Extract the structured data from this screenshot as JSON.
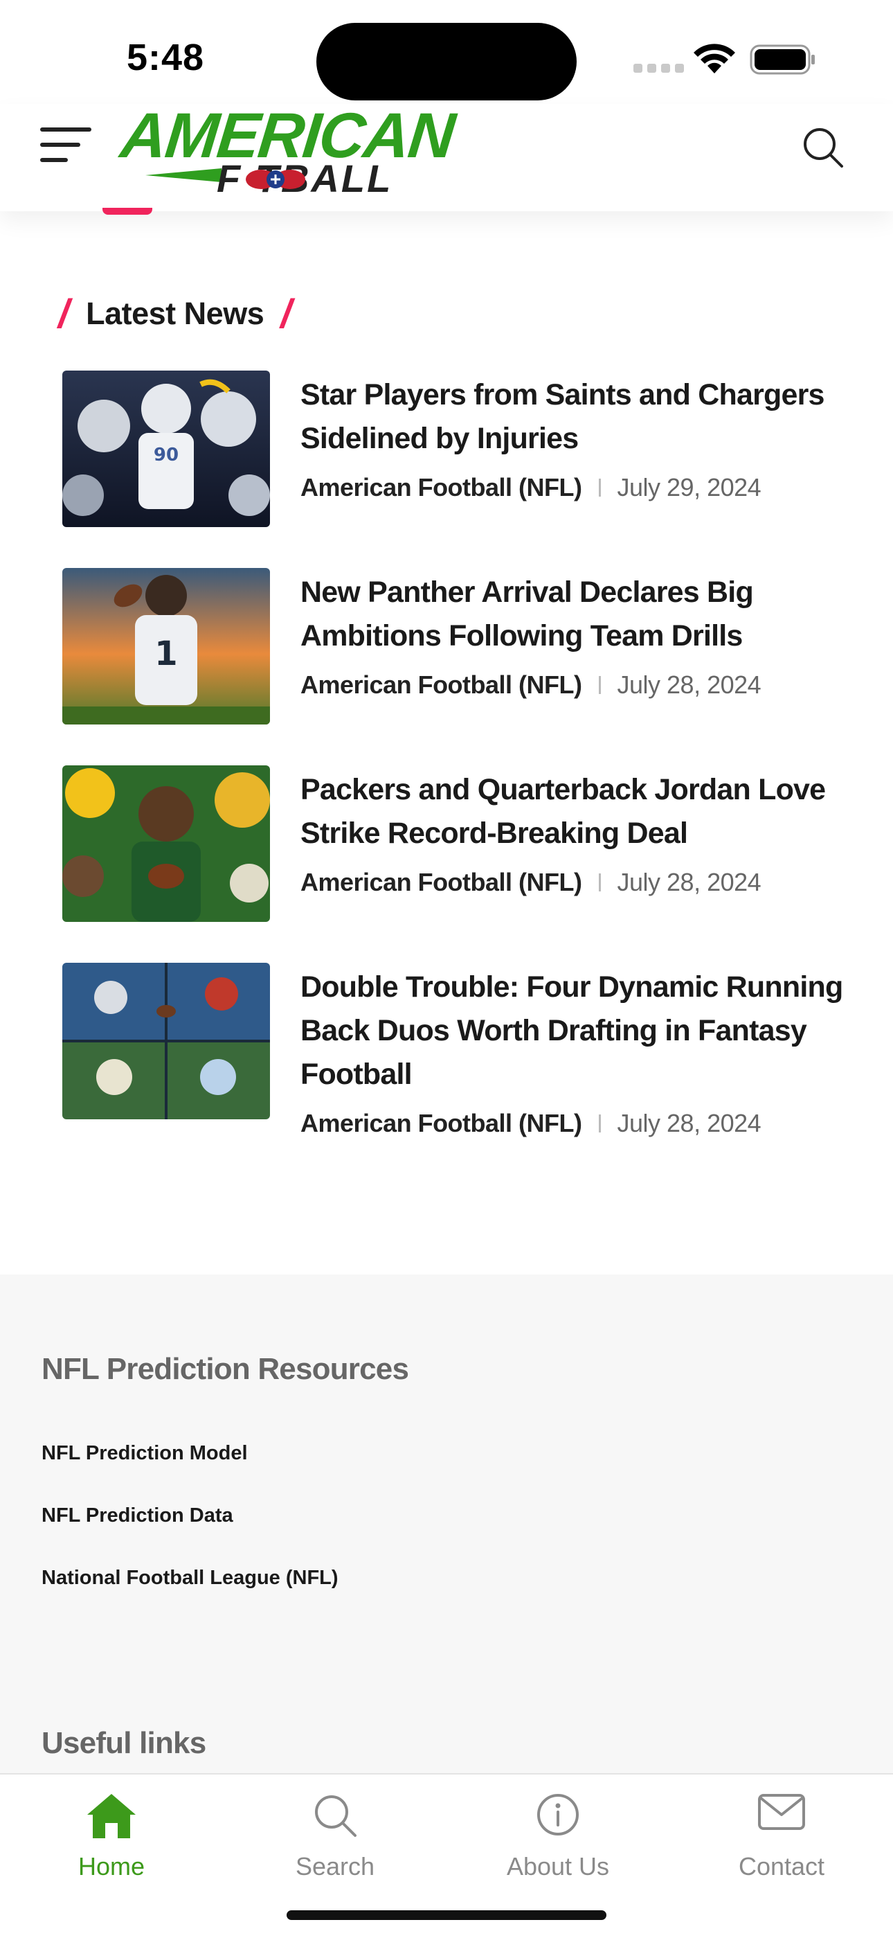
{
  "status_bar": {
    "time": "5:48"
  },
  "header": {
    "logo_line1": "AMERICAN",
    "logo_line2": "F  TBALL"
  },
  "section": {
    "title": "Latest News"
  },
  "news": [
    {
      "title": "Star Players from Saints and Chargers Sidelined by Injuries",
      "category": "American Football (NFL)",
      "date": "July 29, 2024"
    },
    {
      "title": "New Panther Arrival Declares Big Ambitions Following Team Drills",
      "category": "American Football (NFL)",
      "date": "July 28, 2024"
    },
    {
      "title": "Packers and Quarterback Jordan Love Strike Record-Breaking Deal",
      "category": "American Football (NFL)",
      "date": "July 28, 2024"
    },
    {
      "title": "Double Trouble: Four Dynamic Running Back Duos Worth Drafting in Fantasy Football",
      "category": "American Football (NFL)",
      "date": "July 28, 2024"
    }
  ],
  "footer": {
    "resources_heading": "NFL Prediction Resources",
    "links": [
      "NFL Prediction Model",
      "NFL Prediction Data",
      "National Football League (NFL)"
    ],
    "useful_heading": "Useful links"
  },
  "tab_bar": {
    "tabs": [
      {
        "label": "Home",
        "icon": "home-icon"
      },
      {
        "label": "Search",
        "icon": "search-icon"
      },
      {
        "label": "About Us",
        "icon": "info-icon"
      },
      {
        "label": "Contact",
        "icon": "mail-icon"
      }
    ],
    "active_color": "#3d9a1b",
    "inactive_color": "#8a8a8a"
  },
  "colors": {
    "accent": "#f0245c",
    "brand_green": "#2f9e1f"
  }
}
